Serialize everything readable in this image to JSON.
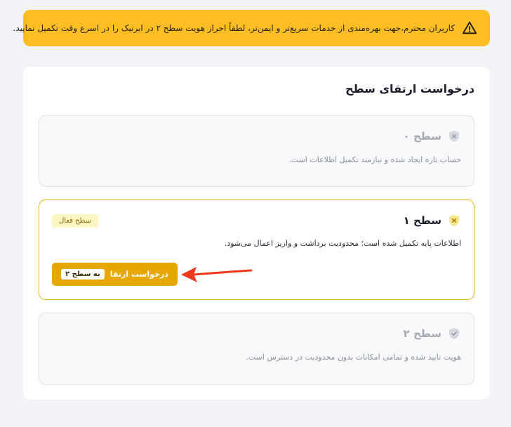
{
  "alert": {
    "icon": "warning-triangle-icon",
    "text": "کاربران محترم،جهت بهره‌مندی از خدمات سریع‌تر و ایمن‌تر، لطفاً احراز هویت سطح ۲ در ایرنیک را در اسرع وقت تکمیل نمایید."
  },
  "panel": {
    "title": "درخواست ارتقای سطح",
    "levels": [
      {
        "name": "سطح ۰",
        "icon": "shield-x-icon",
        "description": "حساب تازه ایجاد شده و نیازمند تکمیل اطلاعات است."
      },
      {
        "name": "سطح ۱",
        "icon": "shield-x-icon",
        "badge": "سطح فعال",
        "description": "اطلاعات پایه تکمیل شده است؛ محدودیت برداشت و واریز اعمال می‌شود.",
        "upgrade_label": "درخواست ارتقا",
        "upgrade_chip": "به سطح ۲"
      },
      {
        "name": "سطح ۲",
        "icon": "shield-check-icon",
        "description": "هویت تایید شده و تمامی امکانات بدون محدودیت در دسترس است."
      }
    ]
  },
  "colors": {
    "alert_bg": "#fcbd25",
    "active_border": "#e8b923",
    "button_bg": "#e6a800",
    "arrow": "#f0391c"
  }
}
